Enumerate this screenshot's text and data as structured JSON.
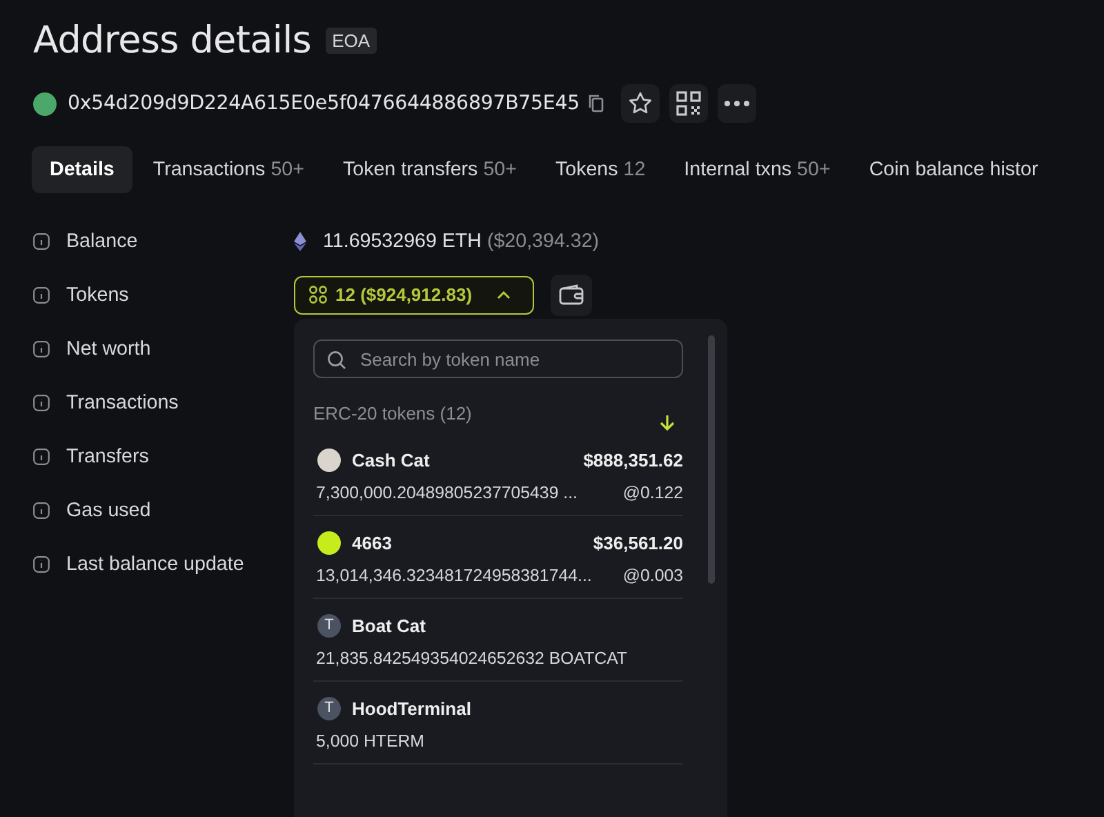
{
  "page": {
    "title": "Address details",
    "badge": "EOA"
  },
  "address": {
    "hash": "0x54d209d9D224A615E0e5f0476644886897B75E45"
  },
  "tabs": [
    {
      "label": "Details",
      "selected": true
    },
    {
      "label": "Transactions",
      "count": "50+",
      "selected": false
    },
    {
      "label": "Token transfers",
      "count": "50+",
      "selected": false
    },
    {
      "label": "Tokens",
      "count": "12",
      "selected": false
    },
    {
      "label": "Internal txns",
      "count": "50+",
      "selected": false
    },
    {
      "label": "Coin balance histor",
      "selected": false
    }
  ],
  "details": [
    {
      "label": "Balance"
    },
    {
      "label": "Tokens"
    },
    {
      "label": "Net worth"
    },
    {
      "label": "Transactions"
    },
    {
      "label": "Transfers"
    },
    {
      "label": "Gas used"
    },
    {
      "label": "Last balance update"
    }
  ],
  "balance": {
    "amount": "11.69532969 ETH",
    "usd": "($20,394.32)"
  },
  "tokens_button": {
    "label": "12 ($924,912.83)",
    "expanded": true
  },
  "dropdown": {
    "search_placeholder": "Search by token name",
    "section": "ERC-20 tokens (12)",
    "items": [
      {
        "name": "Cash Cat",
        "kind": "priced",
        "value": "$888,351.62",
        "amount": "7,300,000.20489805237705439 ...",
        "rate": "@0.122"
      },
      {
        "name": "4663",
        "kind": "priced",
        "value": "$36,561.20",
        "amount": "13,014,346.323481724958381744...",
        "rate": "@0.003"
      },
      {
        "name": "Boat Cat",
        "kind": "plain",
        "letter": "T",
        "amount": "21,835.842549354024652632 BOATCAT"
      },
      {
        "name": "HoodTerminal",
        "kind": "plain",
        "letter": "T",
        "amount": "5,000 HTERM"
      }
    ]
  }
}
